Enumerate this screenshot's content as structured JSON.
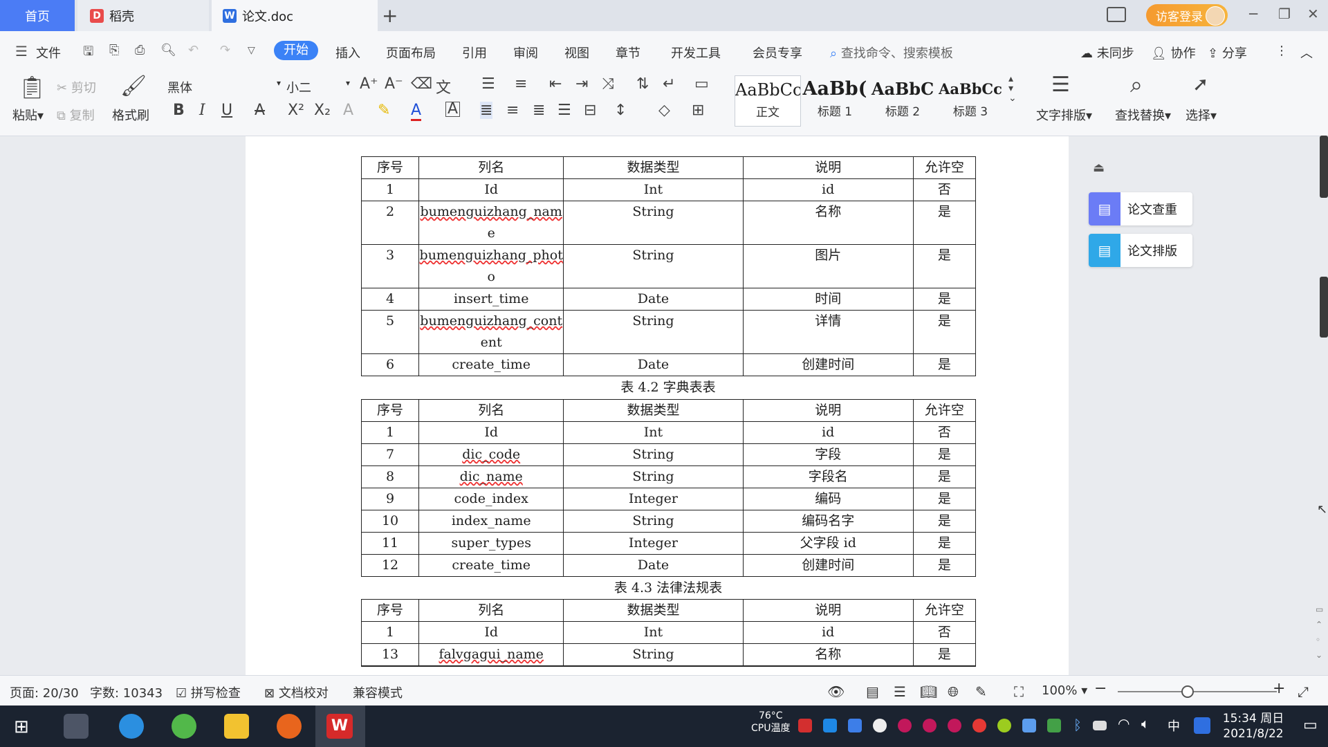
{
  "tabs": [
    {
      "label": "首页"
    },
    {
      "label": "稻壳"
    },
    {
      "label": "论文.doc"
    }
  ],
  "header": {
    "login_label": "访客登录"
  },
  "menu": {
    "file": "文件",
    "items": [
      "开始",
      "插入",
      "页面布局",
      "引用",
      "审阅",
      "视图",
      "章节",
      "开发工具",
      "会员专享"
    ],
    "search_placeholder": "查找命令、搜索模板",
    "sync": "未同步",
    "collab": "协作",
    "share": "分享"
  },
  "ribbon": {
    "paste": "粘贴",
    "cut": "剪切",
    "copy": "复制",
    "format_painter": "格式刷",
    "font_name": "黑体",
    "font_size": "小二",
    "styles": [
      {
        "sample": "AaBbCcI",
        "name": "正文"
      },
      {
        "sample": "AaBb(",
        "name": "标题 1"
      },
      {
        "sample": "AaBbC",
        "name": "标题 2"
      },
      {
        "sample": "AaBbCc",
        "name": "标题 3"
      }
    ],
    "text_layout": "文字排版",
    "find_replace": "查找替换",
    "select": "选择"
  },
  "side": {
    "check": "论文查重",
    "layout": "论文排版"
  },
  "doc": {
    "headers": [
      "序号",
      "列名",
      "数据类型",
      "说明",
      "允许空"
    ],
    "table1": [
      [
        "1",
        "Id",
        "Int",
        "id",
        "否"
      ],
      [
        "2",
        "bumenguizhang_nam",
        "String",
        "名称",
        "是",
        "e"
      ],
      [
        "3",
        "bumenguizhang_phot",
        "String",
        "图片",
        "是",
        "o"
      ],
      [
        "4",
        "insert_time",
        "Date",
        "时间",
        "是"
      ],
      [
        "5",
        "bumenguizhang_cont",
        "String",
        "详情",
        "是",
        "ent"
      ],
      [
        "6",
        "create_time",
        "Date",
        "创建时间",
        "是"
      ]
    ],
    "caption2": "表 4.2 字典表表",
    "table2": [
      [
        "1",
        "Id",
        "Int",
        "id",
        "否"
      ],
      [
        "7",
        "dic_code",
        "String",
        "字段",
        "是"
      ],
      [
        "8",
        "dic_name",
        "String",
        "字段名",
        "是"
      ],
      [
        "9",
        "code_index",
        "Integer",
        "编码",
        "是"
      ],
      [
        "10",
        "index_name",
        "String",
        "编码名字",
        "是"
      ],
      [
        "11",
        "super_types",
        "Integer",
        "父字段 id",
        "是"
      ],
      [
        "12",
        "create_time",
        "Date",
        "创建时间",
        "是"
      ]
    ],
    "caption3": "表 4.3 法律法规表",
    "table3": [
      [
        "1",
        "Id",
        "Int",
        "id",
        "否"
      ],
      [
        "13",
        "falvgagui_name",
        "String",
        "名称",
        "是"
      ]
    ]
  },
  "status": {
    "page": "页面: 20/30",
    "words": "字数: 10343",
    "spell": "拼写检查",
    "proof": "文档校对",
    "compat": "兼容模式",
    "zoom": "100%"
  },
  "taskbar": {
    "temp": "76°C",
    "temp_label": "CPU温度",
    "time": "15:34 周日",
    "date": "2021/8/22",
    "ime": "中"
  },
  "colors": {
    "accent": "#3b82f6",
    "login": "#f5a335",
    "taskbar": "#1b2330"
  }
}
